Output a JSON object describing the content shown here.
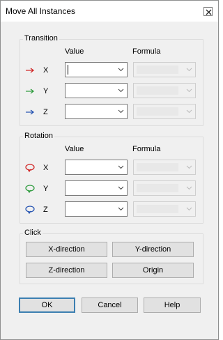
{
  "window": {
    "title": "Move All Instances"
  },
  "transition": {
    "label": "Transition",
    "value_header": "Value",
    "formula_header": "Formula",
    "rows": [
      {
        "axis": "X",
        "color": "#d02020"
      },
      {
        "axis": "Y",
        "color": "#2a9a3a"
      },
      {
        "axis": "Z",
        "color": "#2050b0"
      }
    ]
  },
  "rotation": {
    "label": "Rotation",
    "value_header": "Value",
    "formula_header": "Formula",
    "rows": [
      {
        "axis": "X",
        "color": "#d02020"
      },
      {
        "axis": "Y",
        "color": "#2a9a3a"
      },
      {
        "axis": "Z",
        "color": "#2050b0"
      }
    ]
  },
  "click": {
    "label": "Click",
    "buttons": {
      "x": "X-direction",
      "y": "Y-direction",
      "z": "Z-direction",
      "origin": "Origin"
    }
  },
  "footer": {
    "ok": "OK",
    "cancel": "Cancel",
    "help": "Help"
  }
}
